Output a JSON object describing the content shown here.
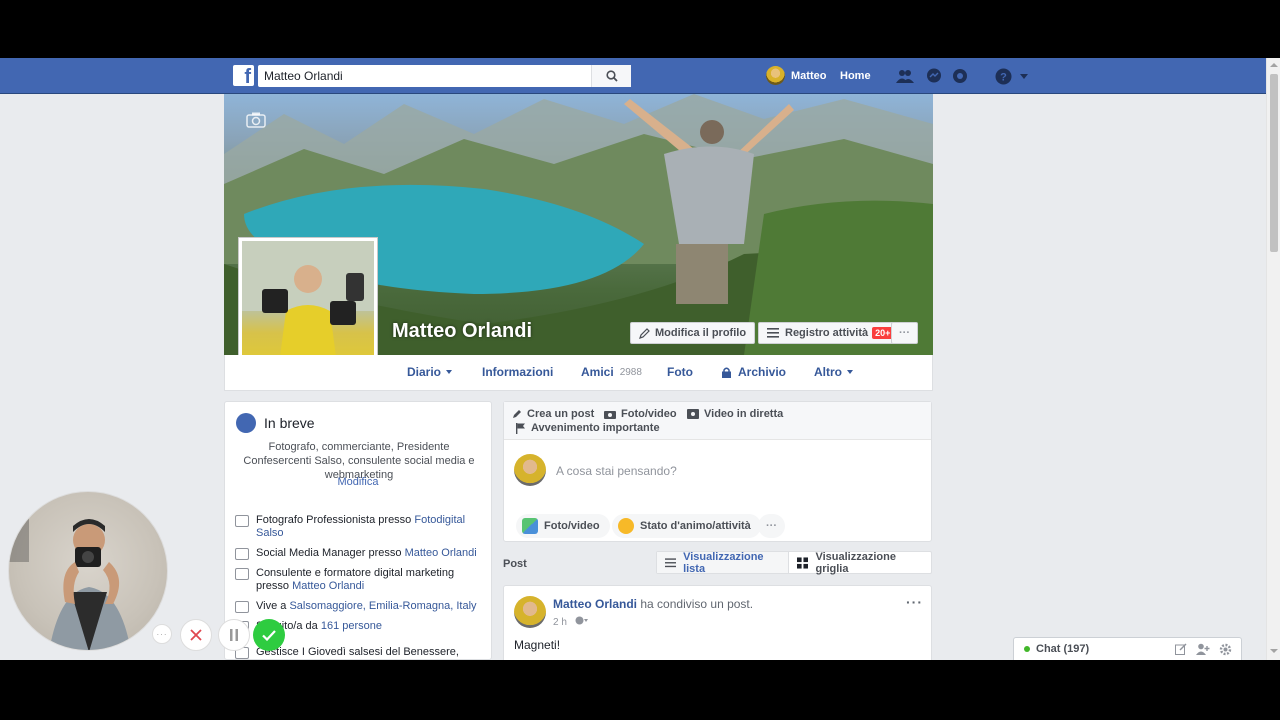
{
  "topbar": {
    "search_value": "Matteo Orlandi",
    "user_name": "Matteo",
    "home_label": "Home",
    "icons": [
      "friends-icon",
      "messenger-icon",
      "notifications-icon",
      "help-icon",
      "account-menu-icon"
    ]
  },
  "profile": {
    "name": "Matteo Orlandi",
    "edit_profile": "Modifica il profilo",
    "activity_log": "Registro attività",
    "activity_badge": "20+",
    "more": "···"
  },
  "tabs": [
    {
      "label": "Diario"
    },
    {
      "label": "Informazioni"
    },
    {
      "label": "Amici",
      "count": "2988"
    },
    {
      "label": "Foto"
    },
    {
      "label": "Archivio"
    },
    {
      "label": "Altro"
    }
  ],
  "intro": {
    "title": "In breve",
    "bio": "Fotografo, commerciante, Presidente Confesercenti Salso, consulente social media e webmarketing",
    "edit": "Modifica",
    "items": [
      {
        "prefix": "Fotografo Professionista presso ",
        "link": "Fotodigital Salso",
        "suffix": ""
      },
      {
        "prefix": "Social Media Manager presso ",
        "link": "Matteo Orlandi",
        "suffix": ""
      },
      {
        "prefix": "Consulente e formatore digital marketing presso ",
        "link": "Matteo Orlandi",
        "suffix": ""
      },
      {
        "prefix": "Vive a ",
        "link": "Salsomaggiore, Emilia-Romagna, Italy",
        "suffix": ""
      },
      {
        "prefix": "Seguito/a da ",
        "link": "161 persone",
        "suffix": ""
      },
      {
        "prefix": "Gestisce I Giovedì salsesi del Benessere,",
        "link": "",
        "suffix": ""
      }
    ]
  },
  "composer": {
    "create_post": "Crea un post",
    "photo_video": "Foto/video",
    "live_video": "Video in diretta",
    "life_event": "Avvenimento importante",
    "placeholder": "A cosa stai pensando?",
    "btn_photo": "Foto/video",
    "btn_feeling": "Stato d'animo/attività",
    "btn_more": "···"
  },
  "posts": {
    "label": "Post",
    "list_view": "Visualizzazione lista",
    "grid_view": "Visualizzazione griglia"
  },
  "post": {
    "author": "Matteo Orlandi",
    "action": "ha condiviso un post.",
    "time": "2 h",
    "text": "Magneti!",
    "more": "···"
  },
  "chat": {
    "label": "Chat (197)"
  },
  "colors": {
    "fb_blue": "#4267b2",
    "link_blue": "#365899",
    "page_bg": "#e9ebee",
    "badge_red": "#fa3e3e",
    "online_green": "#42b72a"
  }
}
